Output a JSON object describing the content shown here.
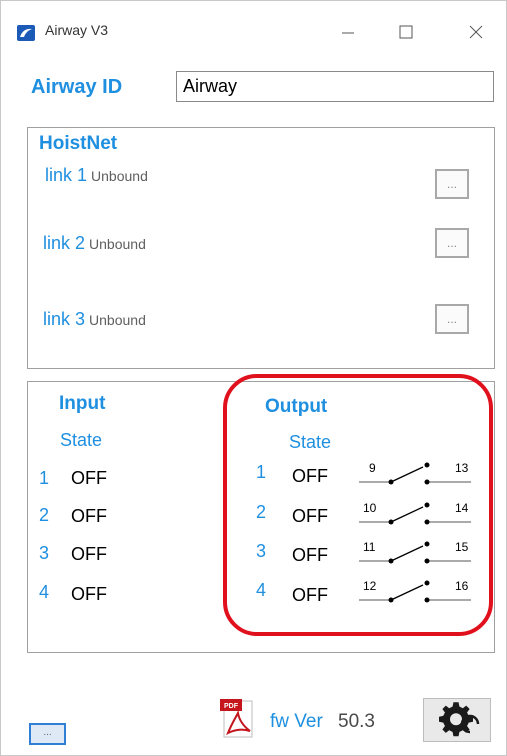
{
  "window": {
    "title": "Airway V3",
    "controls": {
      "minimize": "minimize",
      "maximize": "maximize",
      "close": "close"
    }
  },
  "airway": {
    "label": "Airway ID",
    "value": "Airway"
  },
  "hoistnet": {
    "title": "HoistNet",
    "links": [
      {
        "name": "link 1",
        "status": "Unbound",
        "button": "..."
      },
      {
        "name": "link 2",
        "status": "Unbound",
        "button": "..."
      },
      {
        "name": "link 3",
        "status": "Unbound",
        "button": "..."
      }
    ]
  },
  "input": {
    "title": "Input",
    "state_label": "State",
    "rows": [
      {
        "num": "1",
        "state": "OFF"
      },
      {
        "num": "2",
        "state": "OFF"
      },
      {
        "num": "3",
        "state": "OFF"
      },
      {
        "num": "4",
        "state": "OFF"
      }
    ]
  },
  "output": {
    "title": "Output",
    "state_label": "State",
    "highlight_color": "#e0101c",
    "rows": [
      {
        "num": "1",
        "state": "OFF",
        "relay_left": "9",
        "relay_right": "13"
      },
      {
        "num": "2",
        "state": "OFF",
        "relay_left": "10",
        "relay_right": "14"
      },
      {
        "num": "3",
        "state": "OFF",
        "relay_left": "11",
        "relay_right": "15"
      },
      {
        "num": "4",
        "state": "OFF",
        "relay_left": "12",
        "relay_right": "16"
      }
    ]
  },
  "footer": {
    "small_button": "...",
    "fw_label": "fw Ver",
    "fw_version": "50.3",
    "pdf_icon_text": "PDF",
    "settings_icon": "gear-icon"
  },
  "colors": {
    "accent": "#1f8fe0",
    "highlight": "#e0101c"
  }
}
